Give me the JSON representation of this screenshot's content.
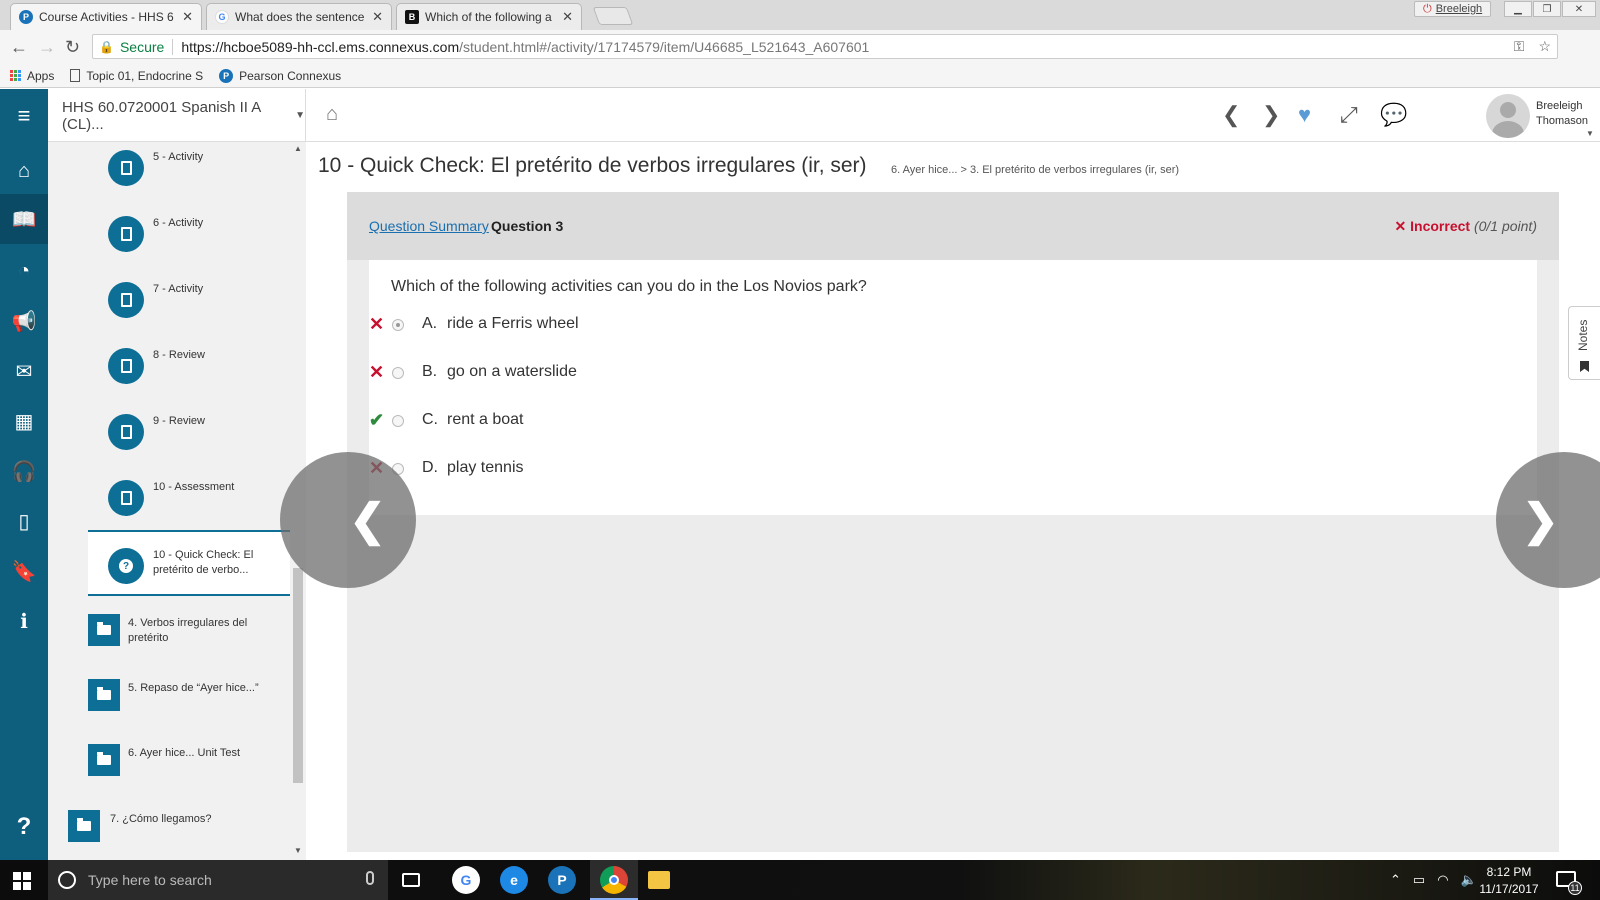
{
  "browser": {
    "tabs": [
      {
        "title": "Course Activities - HHS 6",
        "favicon": "pearson-icon",
        "favicon_color": "#1a73b8",
        "active": true
      },
      {
        "title": "What does the sentence",
        "favicon": "google-icon",
        "favicon_color": "#4285f4",
        "active": false
      },
      {
        "title": "Which of the following a",
        "favicon": "brainly-icon",
        "favicon_color": "#111111",
        "active": false
      }
    ],
    "profile_name": "Breeleigh",
    "secure_label": "Secure",
    "url_host": "https://hcboe5089-hh-ccl.ems.connexus.com",
    "url_path": "/student.html#/activity/17174579/item/U46685_L521643_A607601",
    "bookmarks": [
      {
        "label": "Apps",
        "icon": "apps-grid-icon"
      },
      {
        "label": "Topic 01, Endocrine S",
        "icon": "document-icon"
      },
      {
        "label": "Pearson Connexus",
        "icon": "pearson-icon"
      }
    ]
  },
  "app": {
    "course_name": "HHS 60.0720001 Spanish II A (CL)...",
    "user_first": "Breeleigh",
    "user_last": "Thomason",
    "brand_color": "#0e5e7e",
    "accent_color": "#0e6f96"
  },
  "sidebar": {
    "activities": [
      {
        "label": "5 - Activity"
      },
      {
        "label": "6 - Activity"
      },
      {
        "label": "7 - Activity"
      },
      {
        "label": "8 - Review"
      },
      {
        "label": "9 - Review"
      },
      {
        "label": "10 - Assessment"
      }
    ],
    "current": {
      "label": "10 - Quick Check: El pretérito de verbo..."
    },
    "units": [
      {
        "label": "4. Verbos irregulares del pretérito"
      },
      {
        "label": "5. Repaso de “Ayer hice...”"
      },
      {
        "label": "6. Ayer hice... Unit Test"
      },
      {
        "label": "7. ¿Cómo llegamos?"
      }
    ]
  },
  "main": {
    "title": "10 - Quick Check: El pretérito de verbos irregulares (ir, ser)",
    "breadcrumb": "6. Ayer hice... > 3. El pretérito de verbos irregulares (ir, ser)",
    "question_summary_link": "Question Summary",
    "question_number": "Question 3",
    "result_label": "Incorrect",
    "result_points": "(0/1 point)",
    "result_color": "#c8102e",
    "question_text": "Which of the following activities can you do in the Los Novios park?",
    "options": [
      {
        "letter": "A.",
        "text": "ride a Ferris wheel",
        "mark": "x",
        "selected": true
      },
      {
        "letter": "B.",
        "text": "go on a waterslide",
        "mark": "x",
        "selected": false
      },
      {
        "letter": "C.",
        "text": "rent a boat",
        "mark": "check",
        "selected": false
      },
      {
        "letter": "D.",
        "text": "play tennis",
        "mark": "x",
        "selected": false
      }
    ],
    "notes_label": "Notes"
  },
  "taskbar": {
    "search_placeholder": "Type here to search",
    "time": "8:12 PM",
    "date": "11/17/2017",
    "notification_count": "11"
  }
}
